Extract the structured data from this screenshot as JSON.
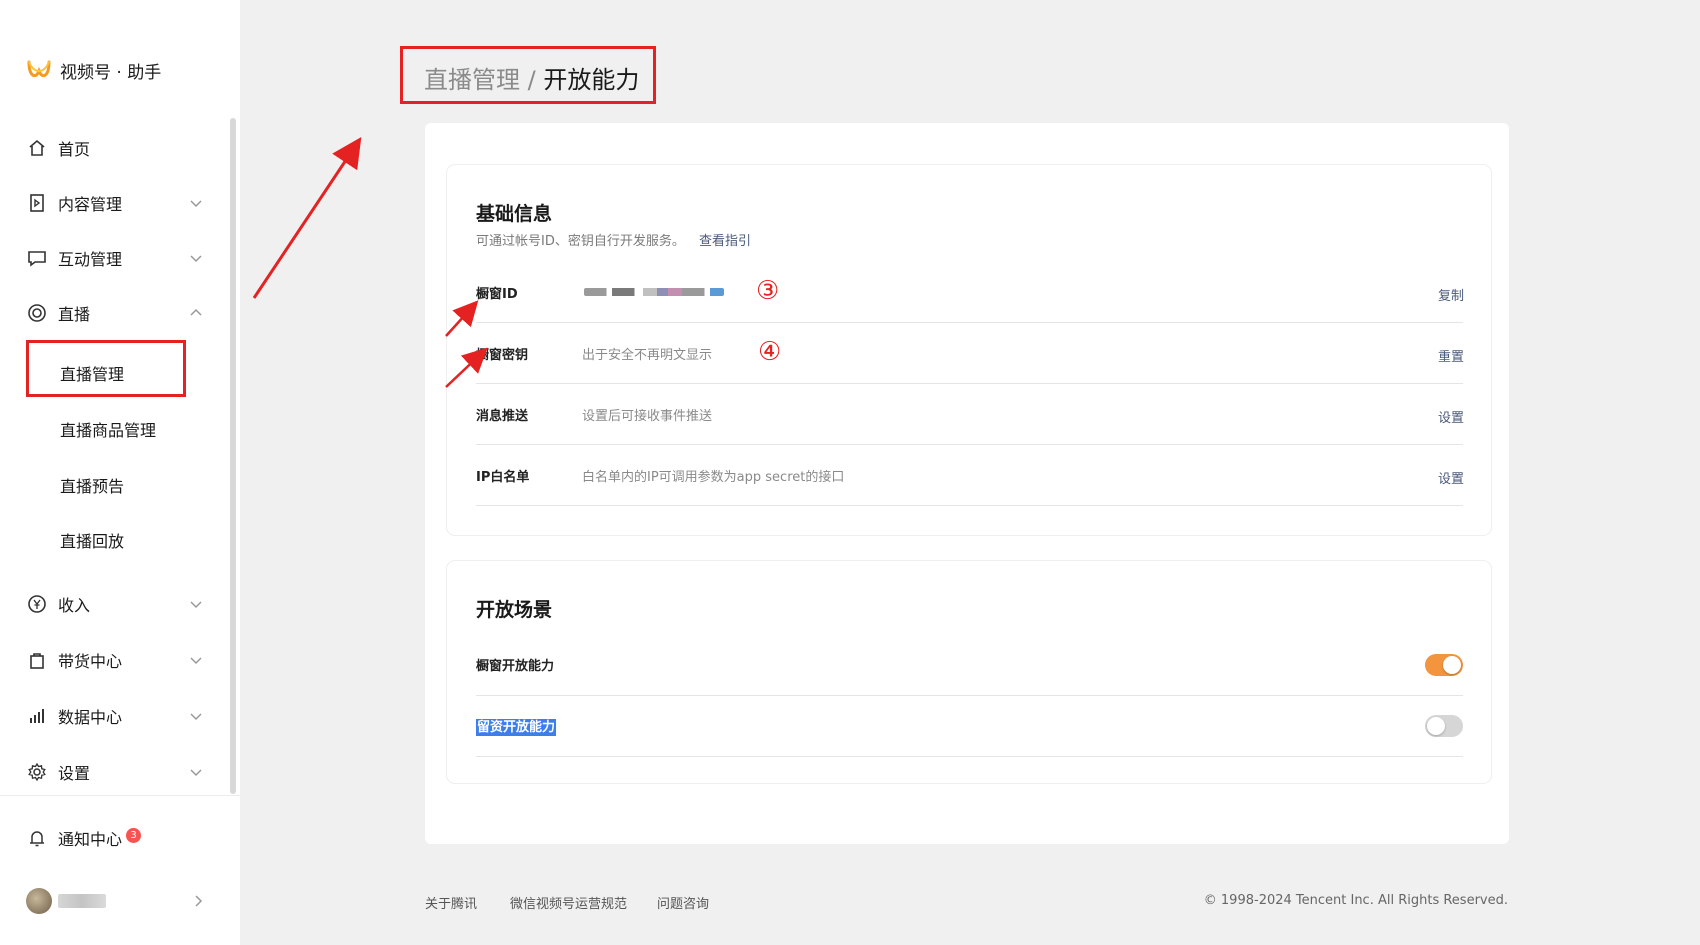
{
  "app": {
    "title": "视频号 · 助手"
  },
  "sidebar": {
    "items": [
      {
        "label": "首页",
        "icon": "home-icon"
      },
      {
        "label": "内容管理",
        "icon": "play-doc-icon"
      },
      {
        "label": "互动管理",
        "icon": "chat-bubble-icon"
      },
      {
        "label": "直播",
        "icon": "live-circle-icon"
      },
      {
        "label": "收入",
        "icon": "yen-circle-icon"
      },
      {
        "label": "带货中心",
        "icon": "shopping-bag-icon"
      },
      {
        "label": "数据中心",
        "icon": "bar-chart-icon"
      },
      {
        "label": "设置",
        "icon": "gear-icon"
      }
    ],
    "live_sub": [
      "直播管理",
      "直播商品管理",
      "直播预告",
      "直播回放"
    ],
    "notify": {
      "label": "通知中心",
      "count": "3"
    }
  },
  "breadcrumb": {
    "parent": "直播管理",
    "separator": "/",
    "current": "开放能力"
  },
  "basic": {
    "title": "基础信息",
    "subtitle": "可通过帐号ID、密钥自行开发服务。",
    "guide_link": "查看指引",
    "rows": [
      {
        "label": "橱窗ID",
        "value": "",
        "action": "复制"
      },
      {
        "label": "橱窗密钥",
        "value": "出于安全不再明文显示",
        "action": "重置"
      },
      {
        "label": "消息推送",
        "value": "设置后可接收事件推送",
        "action": "设置"
      },
      {
        "label": "IP白名单",
        "value": "白名单内的IP可调用参数为app secret的接口",
        "action": "设置"
      }
    ]
  },
  "annotations": {
    "n3": "③",
    "n4": "④"
  },
  "scenes": {
    "title": "开放场景",
    "rows": [
      {
        "label": "橱窗开放能力",
        "enabled": true
      },
      {
        "label": "留资开放能力",
        "enabled": false
      }
    ]
  },
  "footer": {
    "links": [
      "关于腾讯",
      "微信视频号运营规范",
      "问题咨询"
    ],
    "copyright": "© 1998-2024 Tencent Inc. All Rights Reserved."
  },
  "colors": {
    "accent": "#f2953e",
    "annotation_red": "#e52222",
    "highlight": "#3d7eeb"
  }
}
